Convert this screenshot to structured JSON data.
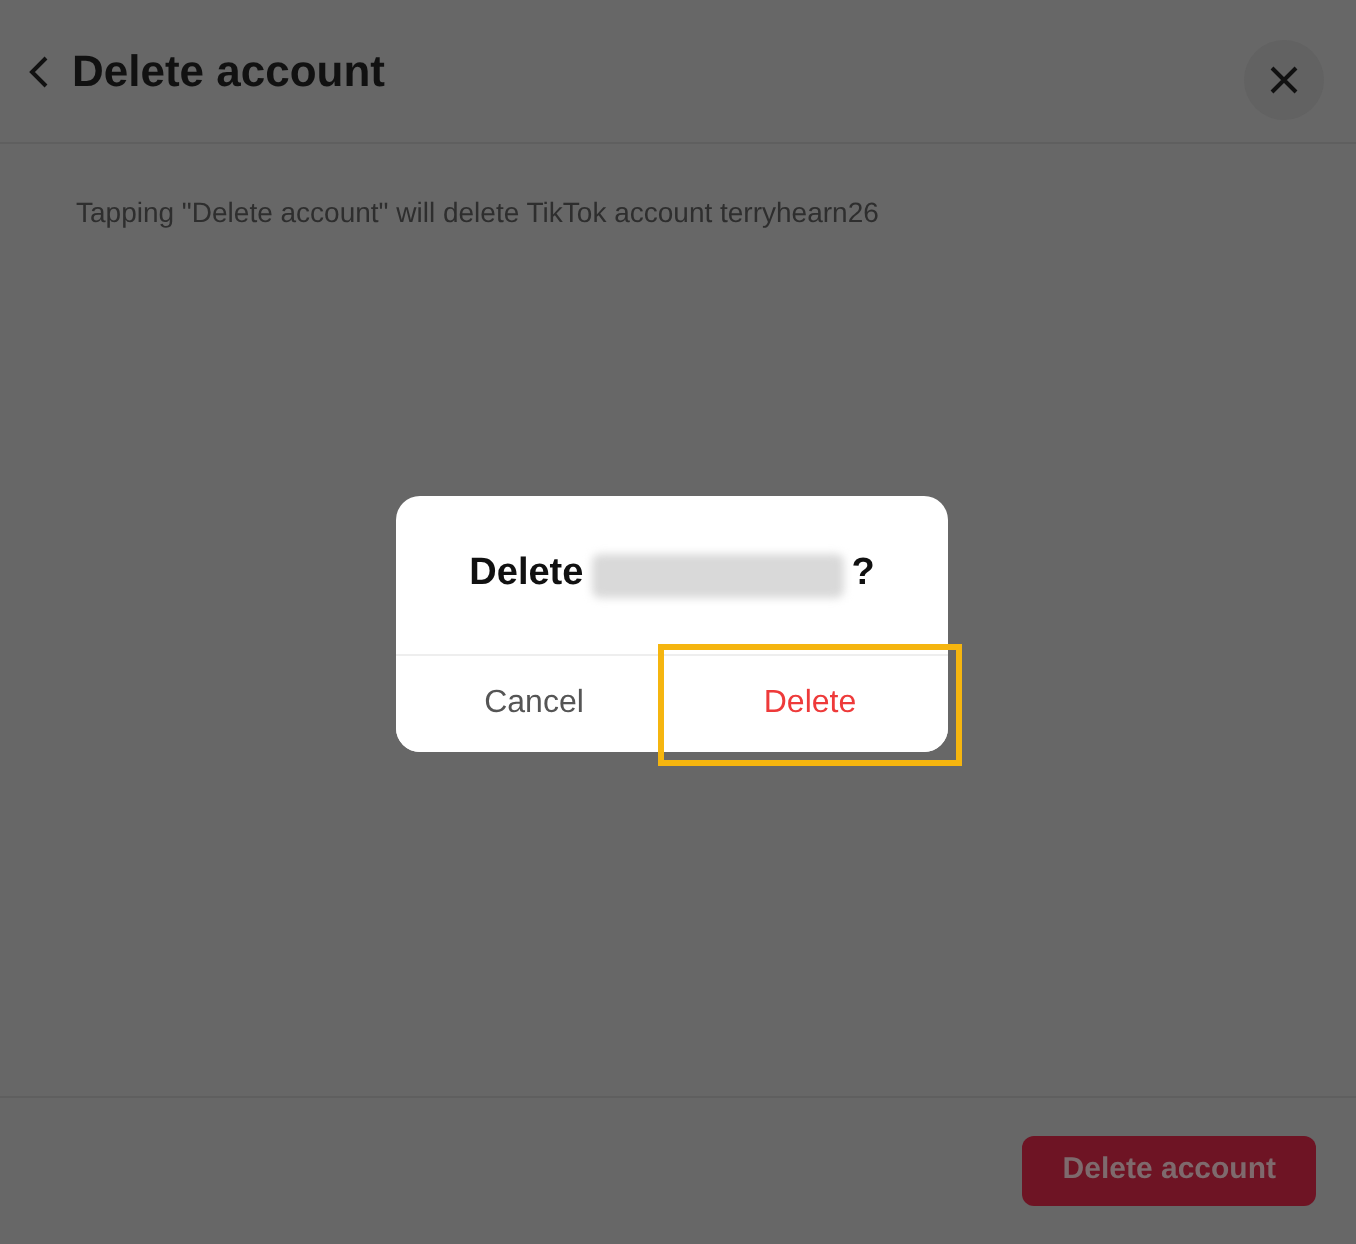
{
  "header": {
    "title": "Delete account"
  },
  "description": "Tapping \"Delete account\" will delete TikTok account terryhearn26",
  "footer": {
    "button": {
      "label": "Delete account",
      "disabled": true
    }
  },
  "dialog": {
    "title_start": "Delete",
    "title_end": "?",
    "buttons": [
      {
        "label": "Cancel",
        "kind": "cancel",
        "highlighted": false
      },
      {
        "label": "Delete",
        "kind": "danger",
        "highlighted": true
      }
    ]
  }
}
